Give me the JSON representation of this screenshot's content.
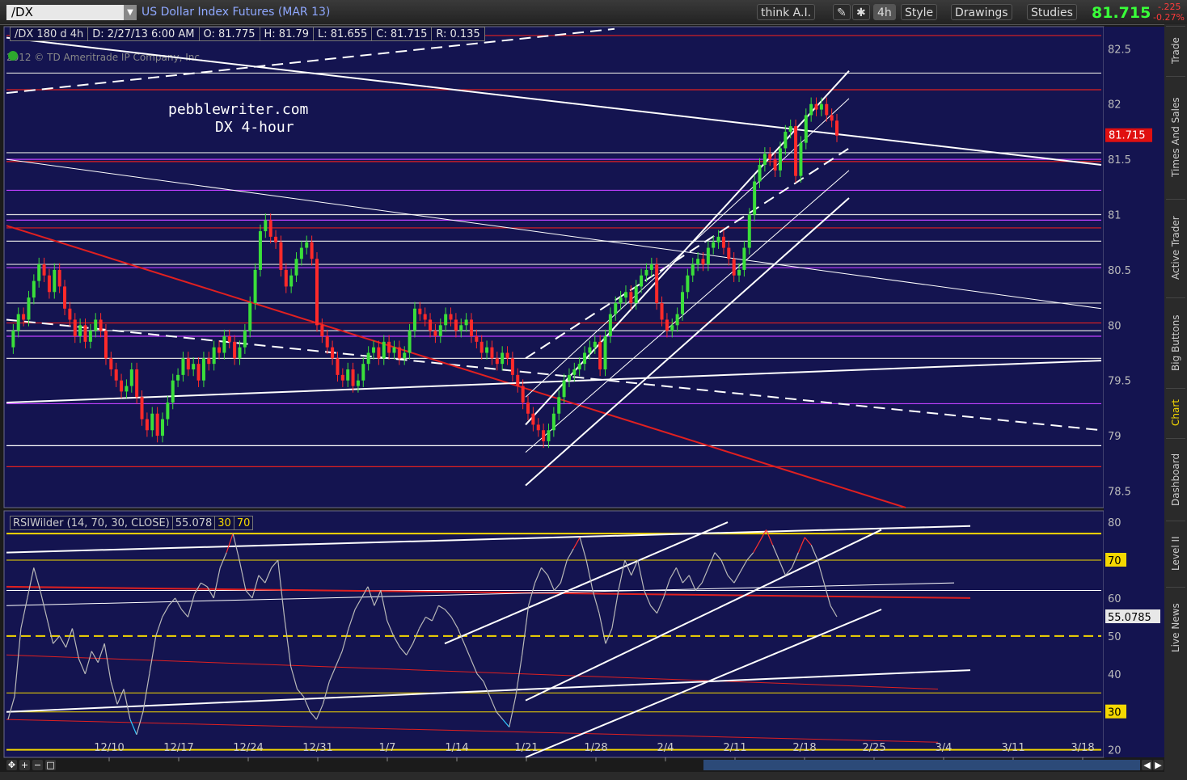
{
  "header": {
    "symbol": "/DX",
    "description": "US Dollar Index Futures (MAR 13)",
    "buttons": [
      "think A.I.",
      "4h",
      "Style",
      "Drawings",
      "Studies"
    ],
    "last_price": "81.715",
    "change_points": "-.225",
    "change_pct": "-0.27%"
  },
  "info_bar": {
    "symbol": "/DX 180 d 4h",
    "date": "D: 2/27/13 6:00 AM",
    "open": "O: 81.775",
    "high": "H: 81.79",
    "low": "L: 81.655",
    "close": "C: 81.715",
    "range": "R: 0.135"
  },
  "copyright": "2012 © TD Ameritrade IP Company, Inc.",
  "watermark": [
    "pebblewriter.com",
    "DX 4-hour"
  ],
  "side_tabs": [
    "Trade",
    "Times And Sales",
    "Active Trader",
    "Big Buttons",
    "Chart",
    "Dashboard",
    "Level II",
    "Live News"
  ],
  "colors": {
    "background": "#141450",
    "up": "#3adf3a",
    "down": "#ff2a2a",
    "magenta": "#c040ff",
    "red_level": "#e02020",
    "yellow": "#f5d800",
    "white": "#ffffff"
  },
  "chart_data": [
    {
      "type": "line",
      "panel": "price",
      "title": "/DX 180 d 4h",
      "ylim": [
        78.35,
        82.7
      ],
      "y_ticks": [
        "82.5",
        "82",
        "81.5",
        "81",
        "80.5",
        "80",
        "79.5",
        "79",
        "78.5"
      ],
      "x_ticks": [
        "12/10",
        "12/17",
        "12/24",
        "12/31",
        "1/7",
        "1/14",
        "1/21",
        "1/28",
        "2/4",
        "2/11",
        "2/18",
        "2/25",
        "3/4",
        "3/11",
        "3/18"
      ],
      "last_price_label": "81.715",
      "series": [
        {
          "values": [
            79.8,
            79.95,
            80.1,
            80.05,
            80.25,
            80.4,
            80.55,
            80.45,
            80.3,
            80.5,
            80.35,
            80.15,
            80.05,
            79.9,
            80.0,
            79.85,
            79.95,
            80.05,
            79.95,
            79.7,
            79.6,
            79.5,
            79.4,
            79.45,
            79.6,
            79.35,
            79.15,
            79.05,
            79.2,
            79.0,
            79.15,
            79.3,
            79.5,
            79.55,
            79.7,
            79.6,
            79.65,
            79.5,
            79.7,
            79.65,
            79.8,
            79.75,
            79.9,
            79.85,
            79.7,
            79.8,
            79.95,
            80.2,
            80.5,
            80.85,
            80.95,
            80.8,
            80.75,
            80.5,
            80.35,
            80.45,
            80.6,
            80.7,
            80.75,
            80.6,
            80.0,
            79.9,
            79.8,
            79.7,
            79.55,
            79.5,
            79.6,
            79.45,
            79.5,
            79.65,
            79.75,
            79.8,
            79.7,
            79.85,
            79.75,
            79.8,
            79.7,
            79.75,
            79.95,
            80.15,
            80.1,
            80.05,
            79.95,
            79.9,
            80.0,
            80.1,
            80.05,
            79.95,
            80.0,
            80.05,
            79.9,
            79.85,
            79.75,
            79.8,
            79.7,
            79.65,
            79.75,
            79.7,
            79.55,
            79.45,
            79.3,
            79.2,
            79.1,
            79.05,
            78.95,
            79.05,
            79.2,
            79.35,
            79.5,
            79.55,
            79.6,
            79.65,
            79.75,
            79.8,
            79.85,
            79.6,
            79.9,
            80.1,
            80.2,
            80.25,
            80.3,
            80.2,
            80.35,
            80.45,
            80.5,
            80.55,
            80.2,
            80.05,
            79.95,
            80.0,
            80.1,
            80.3,
            80.45,
            80.55,
            80.6,
            80.55,
            80.7,
            80.75,
            80.8,
            80.7,
            80.6,
            80.45,
            80.5,
            80.7,
            81.0,
            81.3,
            81.45,
            81.55,
            81.5,
            81.4,
            81.6,
            81.75,
            81.8,
            81.35,
            81.65,
            81.9,
            82.0,
            81.95,
            82.0,
            81.9,
            81.85,
            81.715
          ]
        }
      ],
      "trendlines_drawn": true
    },
    {
      "type": "line",
      "panel": "rsi",
      "title": "RSIWilder (14, 70, 30, CLOSE)",
      "value_label": "55.078",
      "overbought_label": "30",
      "oversold_label": "70",
      "ylim": [
        18,
        83
      ],
      "y_ticks": [
        "80",
        "70",
        "60",
        "50",
        "40",
        "30",
        "20"
      ],
      "highlight_labels": [
        "70",
        "55.0785",
        "30"
      ],
      "series": [
        {
          "values": [
            28,
            34,
            52,
            60,
            68,
            62,
            55,
            48,
            50,
            47,
            52,
            44,
            40,
            46,
            43,
            48,
            38,
            32,
            36,
            28,
            24,
            30,
            40,
            50,
            55,
            58,
            60,
            57,
            55,
            61,
            64,
            63,
            60,
            68,
            72,
            77,
            70,
            62,
            60,
            66,
            64,
            68,
            70,
            55,
            42,
            36,
            34,
            30,
            28,
            32,
            38,
            42,
            46,
            52,
            57,
            60,
            63,
            58,
            62,
            54,
            50,
            47,
            45,
            48,
            52,
            55,
            54,
            58,
            57,
            55,
            52,
            48,
            44,
            40,
            38,
            34,
            30,
            28,
            26,
            34,
            45,
            58,
            64,
            68,
            66,
            62,
            64,
            70,
            73,
            76,
            70,
            62,
            56,
            48,
            52,
            62,
            70,
            66,
            70,
            62,
            58,
            56,
            60,
            65,
            68,
            64,
            66,
            62,
            64,
            68,
            72,
            70,
            66,
            64,
            67,
            70,
            72,
            75,
            78,
            74,
            70,
            66,
            68,
            72,
            76,
            74,
            70,
            64,
            58,
            55.08
          ]
        }
      ]
    }
  ]
}
